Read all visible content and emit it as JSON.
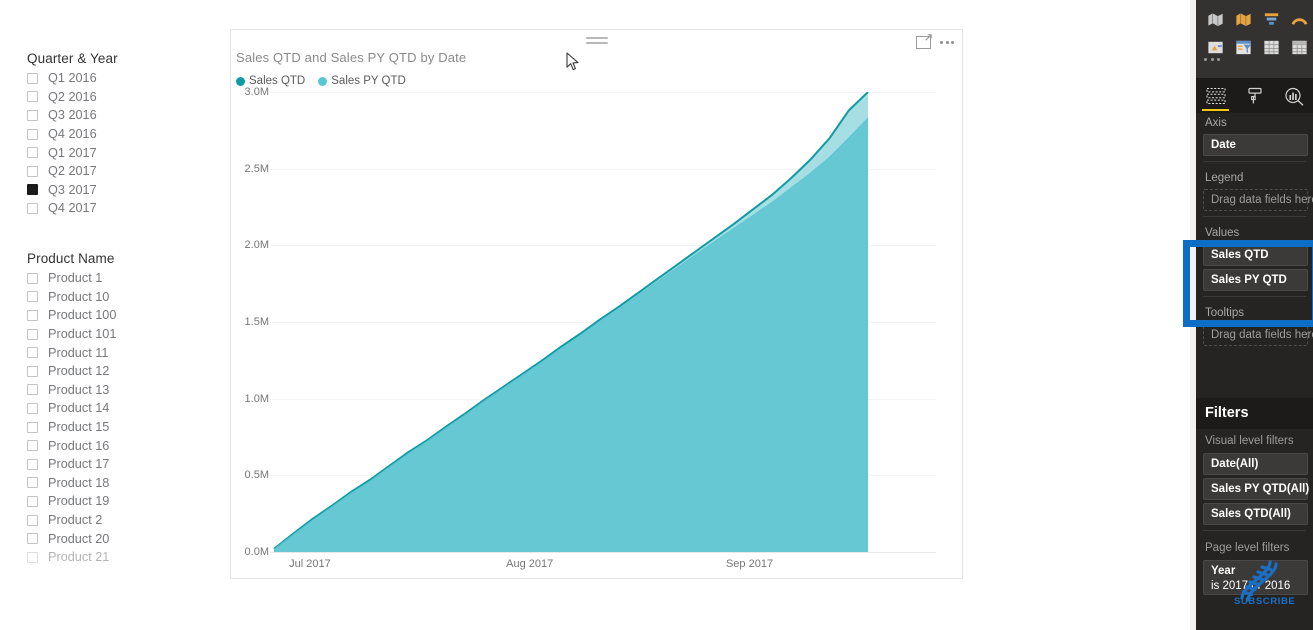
{
  "slicers": [
    {
      "name": "quarter-year",
      "title": "Quarter & Year",
      "items": [
        {
          "label": "Q1 2016",
          "checked": false
        },
        {
          "label": "Q2 2016",
          "checked": false
        },
        {
          "label": "Q3 2016",
          "checked": false
        },
        {
          "label": "Q4 2016",
          "checked": false
        },
        {
          "label": "Q1 2017",
          "checked": false
        },
        {
          "label": "Q2 2017",
          "checked": false
        },
        {
          "label": "Q3 2017",
          "checked": true
        },
        {
          "label": "Q4 2017",
          "checked": false
        }
      ]
    },
    {
      "name": "product-name",
      "title": "Product Name",
      "items": [
        {
          "label": "Product 1",
          "checked": false
        },
        {
          "label": "Product 10",
          "checked": false
        },
        {
          "label": "Product 100",
          "checked": false
        },
        {
          "label": "Product 101",
          "checked": false
        },
        {
          "label": "Product 11",
          "checked": false
        },
        {
          "label": "Product 12",
          "checked": false
        },
        {
          "label": "Product 13",
          "checked": false
        },
        {
          "label": "Product 14",
          "checked": false
        },
        {
          "label": "Product 15",
          "checked": false
        },
        {
          "label": "Product 16",
          "checked": false
        },
        {
          "label": "Product 17",
          "checked": false
        },
        {
          "label": "Product 18",
          "checked": false
        },
        {
          "label": "Product 19",
          "checked": false
        },
        {
          "label": "Product 2",
          "checked": false
        },
        {
          "label": "Product 20",
          "checked": false
        },
        {
          "label": "Product 21",
          "checked": false
        }
      ]
    }
  ],
  "visual": {
    "title": "Sales QTD and Sales PY QTD by Date",
    "focus_icon": "focus-mode-icon",
    "more_icon": "more-options-icon",
    "drag_handle_icon": "drag-handle-icon"
  },
  "chart_data": {
    "type": "area",
    "title": "Sales QTD and Sales PY QTD by Date",
    "xlabel": "",
    "ylabel": "",
    "grid": true,
    "legend_position": "top-left",
    "ylim": [
      0,
      3000000
    ],
    "ytick_labels": [
      "0.0M",
      "0.5M",
      "1.0M",
      "1.5M",
      "2.0M",
      "2.5M",
      "3.0M"
    ],
    "ytick_values": [
      0,
      500000,
      1000000,
      1500000,
      2000000,
      2500000,
      3000000
    ],
    "xtick_labels": [
      "Jul 2017",
      "Aug 2017",
      "Sep 2017"
    ],
    "xtick_positions": [
      0.06,
      0.39,
      0.72
    ],
    "x": [
      "2017-07-01",
      "2017-07-04",
      "2017-07-07",
      "2017-07-10",
      "2017-07-13",
      "2017-07-16",
      "2017-07-19",
      "2017-07-22",
      "2017-07-25",
      "2017-07-28",
      "2017-07-31",
      "2017-08-03",
      "2017-08-06",
      "2017-08-09",
      "2017-08-12",
      "2017-08-15",
      "2017-08-18",
      "2017-08-21",
      "2017-08-24",
      "2017-08-27",
      "2017-08-30",
      "2017-09-02",
      "2017-09-05",
      "2017-09-08",
      "2017-09-11",
      "2017-09-14",
      "2017-09-17",
      "2017-09-20",
      "2017-09-23",
      "2017-09-26",
      "2017-09-29",
      "2017-09-30"
    ],
    "series": [
      {
        "name": "Sales QTD",
        "color": "#0f9ba4",
        "fill": "#8ed5dd",
        "values": [
          20000,
          120000,
          215000,
          300000,
          390000,
          470000,
          560000,
          650000,
          730000,
          820000,
          905000,
          995000,
          1080000,
          1165000,
          1250000,
          1340000,
          1425000,
          1515000,
          1600000,
          1690000,
          1780000,
          1870000,
          1960000,
          2050000,
          2140000,
          2235000,
          2330000,
          2440000,
          2560000,
          2700000,
          2880000,
          3000000
        ]
      },
      {
        "name": "Sales PY QTD",
        "color": "#59c6d3",
        "fill": "#62c6d1",
        "values": [
          15000,
          112000,
          205000,
          292000,
          380000,
          460000,
          552000,
          640000,
          722000,
          810000,
          895000,
          985000,
          1070000,
          1155000,
          1240000,
          1328000,
          1412000,
          1500000,
          1585000,
          1675000,
          1762000,
          1850000,
          1938000,
          2025000,
          2110000,
          2195000,
          2280000,
          2375000,
          2470000,
          2575000,
          2700000,
          2830000
        ]
      }
    ]
  },
  "right_pane": {
    "visualizations_icons": [
      "map-icon",
      "filled-map-icon",
      "funnel-partial-icon",
      "gauge-partial-icon",
      "shape-map-icon",
      "globe-map-icon",
      "funnel-icon",
      "gauge-icon",
      "card-icon",
      "slicer-icon",
      "table-icon",
      "matrix-icon"
    ],
    "more_visuals_icon": "more-visuals-icon",
    "tabs": [
      {
        "name": "fields-tab",
        "icon": "fields-icon",
        "active": true
      },
      {
        "name": "format-tab",
        "icon": "paint-roller-icon",
        "active": false
      },
      {
        "name": "analytics-tab",
        "icon": "analytics-magnifier-icon",
        "active": false
      }
    ],
    "field_wells": [
      {
        "label": "Axis",
        "items": [
          "Date"
        ],
        "placeholder": null
      },
      {
        "label": "Legend",
        "items": [],
        "placeholder": "Drag data fields here"
      },
      {
        "label": "Values",
        "items": [
          "Sales QTD",
          "Sales PY QTD"
        ],
        "placeholder": null
      },
      {
        "label": "Tooltips",
        "items": [],
        "placeholder": "Drag data fields here"
      }
    ],
    "filters": {
      "title": "Filters",
      "visual_level_label": "Visual level filters",
      "visual_level_items": [
        "Date(All)",
        "Sales PY QTD(All)",
        "Sales QTD(All)"
      ],
      "page_level_label": "Page level filters",
      "page_level_items": [
        {
          "field": "Year",
          "condition": "is 2017 or 2016"
        }
      ]
    },
    "highlight_color": "#0c6fc5"
  },
  "watermark": {
    "icon": "dna-helix-icon",
    "text": "SUBSCRIBE",
    "color": "#1a6fc4"
  },
  "cursor": {
    "icon": "mouse-pointer-icon"
  }
}
